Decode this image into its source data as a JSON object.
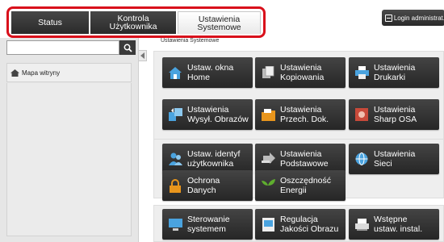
{
  "tabs": [
    {
      "label": "Status"
    },
    {
      "label": "Kontrola\nUżytkownika"
    },
    {
      "label": "Ustawienia\nSystemowe"
    }
  ],
  "login": {
    "label": "Login administrat."
  },
  "sidebar": {
    "search_value": "",
    "items": [
      {
        "label": "Mapa witryny"
      }
    ]
  },
  "main": {
    "breadcrumb": "Ustawienia Systemowe",
    "tiles": [
      {
        "label": "Ustaw. okna\nHome",
        "icon": "home-icon"
      },
      {
        "label": "Ustawienia\nKopiowania",
        "icon": "copy-icon"
      },
      {
        "label": "Ustawienia\nDrukarki",
        "icon": "printer-icon"
      },
      {
        "label": "Ustawienia\nWysył. Obrazów",
        "icon": "image-send-icon"
      },
      {
        "label": "Ustawienia\nPrzech. Dok.",
        "icon": "document-filing-icon"
      },
      {
        "label": "Ustawienia\nSharp OSA",
        "icon": "sharp-osa-icon"
      },
      {
        "label": "Ustaw. identyf\nużytkownika",
        "icon": "user-auth-icon"
      },
      {
        "label": "Ustawienia\nPodstawowe",
        "icon": "common-settings-icon"
      },
      {
        "label": "Ustawienia\nSieci",
        "icon": "network-icon"
      },
      {
        "label": "Ochrona\nDanych",
        "icon": "lock-icon"
      },
      {
        "label": "Oszczędność\nEnergii",
        "icon": "leaf-icon"
      },
      {
        "label": "Sterowanie\nsystemem",
        "icon": "system-control-icon"
      },
      {
        "label": "Regulacja\nJakości Obrazu",
        "icon": "image-quality-icon"
      },
      {
        "label": "Wstępne\nustaw. instal.",
        "icon": "initial-setup-icon"
      }
    ]
  },
  "colors": {
    "highlight": "#d9101b",
    "tile_dark": "#333333",
    "group_bg": "#eeeeee",
    "icon_blue": "#4aa3df",
    "icon_orange": "#e8951c",
    "icon_green": "#5fae2e"
  }
}
